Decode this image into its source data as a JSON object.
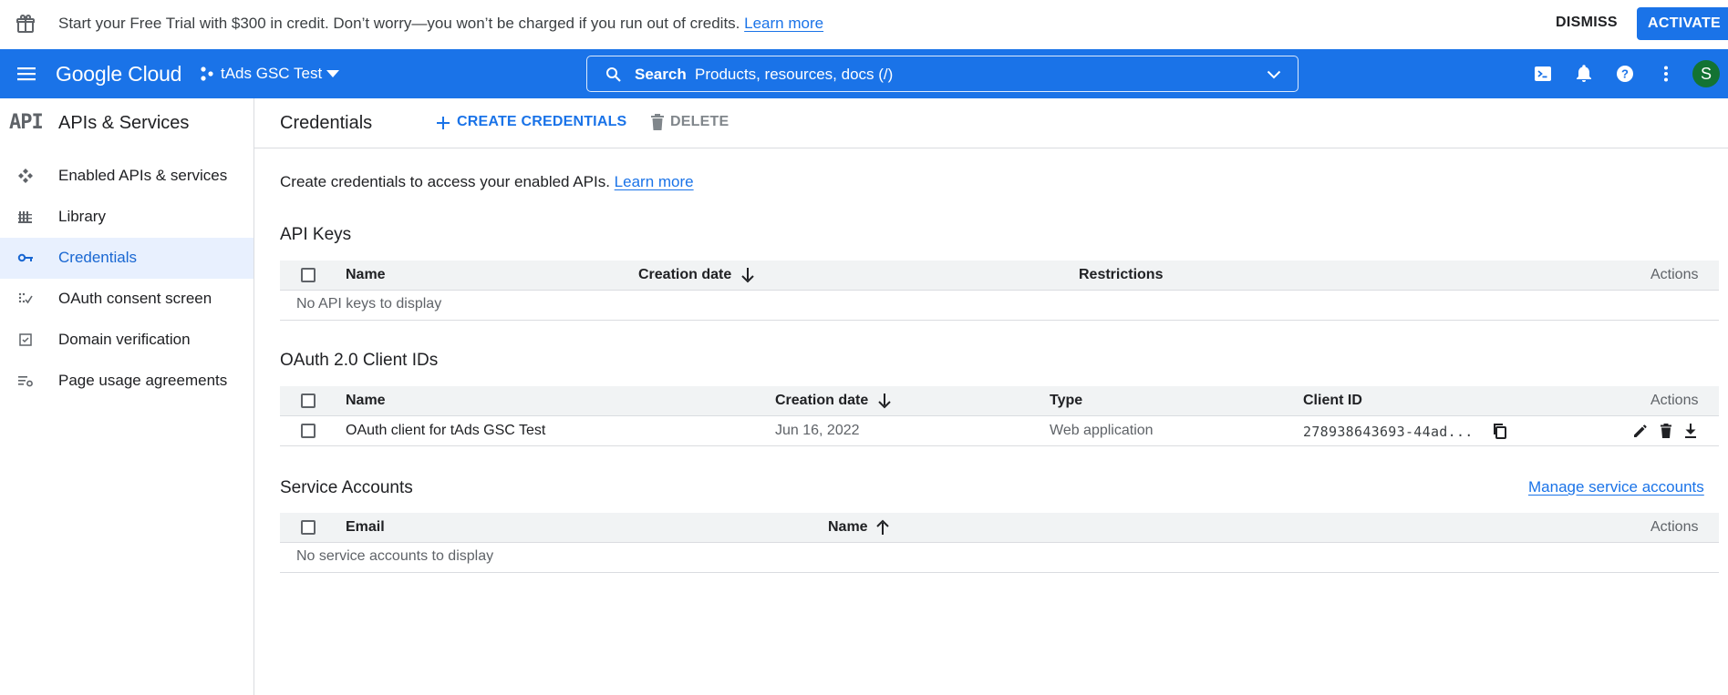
{
  "banner": {
    "message": "Start your Free Trial with $300 in credit. Don’t worry—you won’t be charged if you run out of credits.",
    "learn_more": "Learn more",
    "dismiss": "DISMISS",
    "activate": "ACTIVATE"
  },
  "header": {
    "logo": "Google Cloud",
    "project": "tAds GSC Test",
    "search_label": "Search",
    "search_placeholder": "Products, resources, docs (/)",
    "avatar_initial": "S",
    "icons": [
      "terminal-icon",
      "bell-icon",
      "help-icon",
      "more-vert-icon"
    ]
  },
  "sidebar": {
    "logo_text": "API",
    "title": "APIs & Services",
    "items": [
      {
        "label": "Enabled APIs & services",
        "icon": "enabled-apis-icon"
      },
      {
        "label": "Library",
        "icon": "library-icon"
      },
      {
        "label": "Credentials",
        "icon": "key-icon",
        "active": true
      },
      {
        "label": "OAuth consent screen",
        "icon": "consent-icon"
      },
      {
        "label": "Domain verification",
        "icon": "checkbox-icon"
      },
      {
        "label": "Page usage agreements",
        "icon": "settings-list-icon"
      }
    ]
  },
  "toolbar": {
    "title": "Credentials",
    "create_label": "CREATE CREDENTIALS",
    "delete_label": "DELETE"
  },
  "intro": {
    "text": "Create credentials to access your enabled APIs.",
    "learn_more": "Learn more"
  },
  "api_keys": {
    "title": "API Keys",
    "columns": [
      "Name",
      "Creation date",
      "Restrictions",
      "Actions"
    ],
    "empty": "No API keys to display"
  },
  "oauth": {
    "title": "OAuth 2.0 Client IDs",
    "columns": [
      "Name",
      "Creation date",
      "Type",
      "Client ID",
      "Actions"
    ],
    "rows": [
      {
        "name": "OAuth client for tAds GSC Test",
        "date": "Jun 16, 2022",
        "type": "Web application",
        "client_id": "278938643693-44ad..."
      }
    ]
  },
  "service_accounts": {
    "title": "Service Accounts",
    "manage_link": "Manage service accounts",
    "columns": [
      "Email",
      "Name",
      "Actions"
    ],
    "empty": "No service accounts to display"
  },
  "colors": {
    "primary": "#1a73e8",
    "avatar": "#137333",
    "active_bg": "#e8f0fe"
  }
}
